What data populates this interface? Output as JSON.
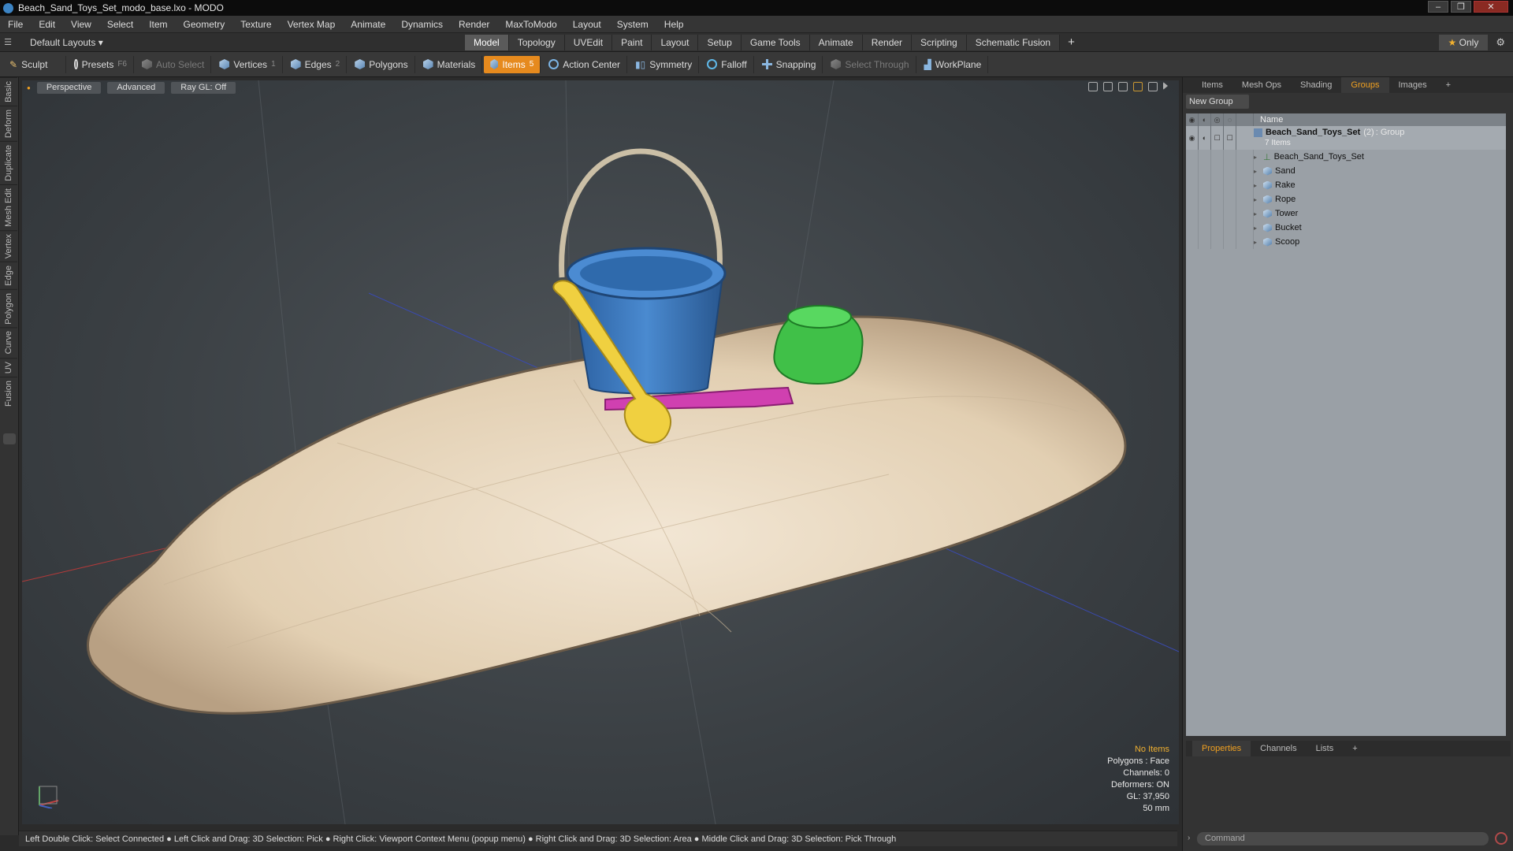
{
  "window": {
    "title": "Beach_Sand_Toys_Set_modo_base.lxo - MODO",
    "controls": [
      "–",
      "❐",
      "✕"
    ]
  },
  "menu": [
    "File",
    "Edit",
    "View",
    "Select",
    "Item",
    "Geometry",
    "Texture",
    "Vertex Map",
    "Animate",
    "Dynamics",
    "Render",
    "MaxToModo",
    "Layout",
    "System",
    "Help"
  ],
  "layoutbar": {
    "layouts_label": "Default Layouts",
    "tabs": [
      "Model",
      "Topology",
      "UVEdit",
      "Paint",
      "Layout",
      "Setup",
      "Game Tools",
      "Animate",
      "Render",
      "Scripting",
      "Schematic Fusion"
    ],
    "active_tab": "Model",
    "add": "+",
    "only_label": "Only"
  },
  "toolbar": {
    "sculpt": "Sculpt",
    "presets": "Presets",
    "presets_key": "F6",
    "auto_select": "Auto Select",
    "vertices": "Vertices",
    "vertices_count": "1",
    "edges": "Edges",
    "edges_count": "2",
    "polygons": "Polygons",
    "materials": "Materials",
    "items": "Items",
    "items_count": "5",
    "action_center": "Action Center",
    "symmetry": "Symmetry",
    "falloff": "Falloff",
    "snapping": "Snapping",
    "select_through": "Select Through",
    "workplane": "WorkPlane"
  },
  "left_tabs": [
    "Basic",
    "Deform",
    "Duplicate",
    "Mesh Edit",
    "Vertex",
    "Edge",
    "Polygon",
    "Curve",
    "UV",
    "Fusion"
  ],
  "viewport": {
    "view_mode": "Perspective",
    "shading": "Advanced",
    "raygl": "Ray GL: Off",
    "info": {
      "selection": "No Items",
      "polygons": "Polygons : Face",
      "channels": "Channels: 0",
      "deformers": "Deformers: ON",
      "gl": "GL: 37,950",
      "scale": "50 mm"
    }
  },
  "status_bar": "Left Double Click: Select Connected ● Left Click and Drag: 3D Selection: Pick ● Right Click: Viewport Context Menu (popup menu) ● Right Click and Drag: 3D Selection: Area ● Middle Click and Drag: 3D Selection: Pick Through",
  "right_panel": {
    "tabs": [
      "Items",
      "Mesh Ops",
      "Shading",
      "Groups",
      "Images"
    ],
    "active_tab": "Groups",
    "add": "+",
    "new_group": "New Group",
    "column_name": "Name",
    "group": {
      "name": "Beach_Sand_Toys_Set",
      "count": "(2)",
      "type": ": Group",
      "items_note": "7 Items"
    },
    "children": [
      "Beach_Sand_Toys_Set",
      "Sand",
      "Rake",
      "Rope",
      "Tower",
      "Bucket",
      "Scoop"
    ],
    "bottom_tabs": [
      "Properties",
      "Channels",
      "Lists"
    ],
    "bottom_active": "Properties",
    "command_placeholder": "Command"
  },
  "colors": {
    "accent": "#e68a1e",
    "sand": "#e8d8c0",
    "bucket": "#3a78c0",
    "scoop": "#f0d040",
    "rake": "#d040b0",
    "tower": "#40c048"
  }
}
